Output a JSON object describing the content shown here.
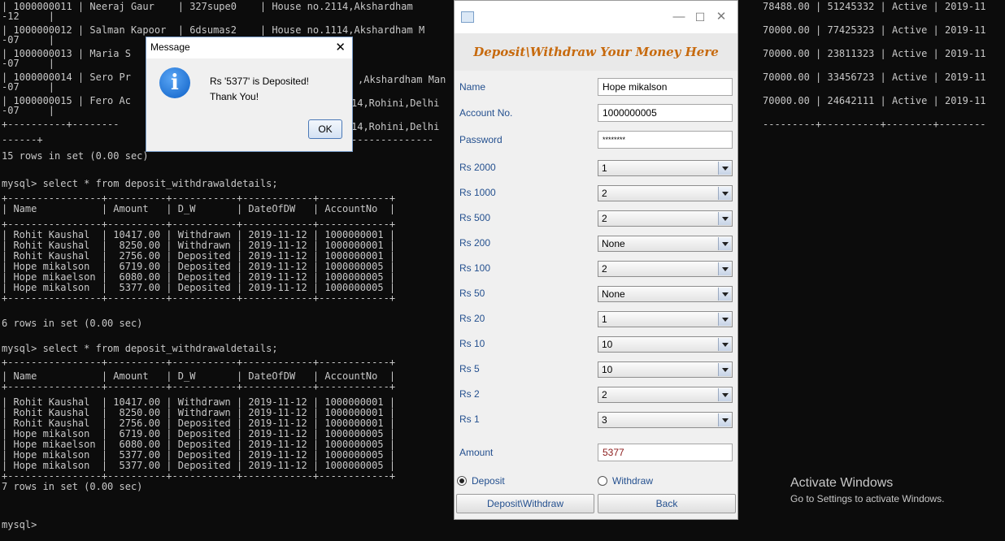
{
  "terminal": {
    "left_lines": [
      "| 1000000011 | Neeraj Gaur    | 327supe0    | House no.2114,Akshardham",
      "-12     |",
      "| 1000000012 | Salman Kapoor  | 6dsumas2    | House no.1114,Akshardham M",
      "-07     |",
      "| 1000000013 | Maria S",
      "-07     |",
      "| 1000000014 | Sero Pr",
      "-07     |",
      "| 1000000015 | Fero Ac",
      "-07     |",
      "+----------+--------",
      "",
      "------+",
      "15 rows in set (0.00 sec)",
      "",
      "mysql> select * from deposit_withdrawaldetails;",
      "+----------------+----------+-----------+------------+------------+",
      "| Name           | Amount   | D_W       | DateOfDW   | AccountNo  |",
      "+----------------+----------+-----------+------------+------------+",
      "| Rohit Kaushal  | 10417.00 | Withdrawn | 2019-11-12 | 1000000001 |",
      "| Rohit Kaushal  |  8250.00 | Withdrawn | 2019-11-12 | 1000000001 |",
      "| Rohit Kaushal  |  2756.00 | Deposited | 2019-11-12 | 1000000001 |",
      "| Hope mikalson  |  6719.00 | Deposited | 2019-11-12 | 1000000005 |",
      "| Hope mikaelson |  6080.00 | Deposited | 2019-11-12 | 1000000005 |",
      "| Hope mikalson  |  5377.00 | Deposited | 2019-11-12 | 1000000005 |",
      "+----------------+----------+-----------+------------+------------+",
      "6 rows in set (0.00 sec)",
      "",
      "mysql> select * from deposit_withdrawaldetails;",
      "+----------------+----------+-----------+------------+------------+",
      "| Name           | Amount   | D_W       | DateOfDW   | AccountNo  |",
      "+----------------+----------+-----------+------------+------------+",
      "| Rohit Kaushal  | 10417.00 | Withdrawn | 2019-11-12 | 1000000001 |",
      "| Rohit Kaushal  |  8250.00 | Withdrawn | 2019-11-12 | 1000000001 |",
      "| Rohit Kaushal  |  2756.00 | Deposited | 2019-11-12 | 1000000001 |",
      "| Hope mikalson  |  6719.00 | Deposited | 2019-11-12 | 1000000005 |",
      "| Hope mikaelson |  6080.00 | Deposited | 2019-11-12 | 1000000005 |",
      "| Hope mikalson  |  5377.00 | Deposited | 2019-11-12 | 1000000005 |",
      "| Hope mikalson  |  5377.00 | Deposited | 2019-11-12 | 1000000005 |",
      "+----------------+----------+-----------+------------+------------+",
      "7 rows in set (0.00 sec)",
      "",
      "mysql>"
    ],
    "mid_lines": [
      ",Akshardham Man",
      "14,Rohini,Delhi",
      "14,Rohini,Delhi",
      "--------------"
    ],
    "right_lines": [
      "78488.00 | 51245332 | Active | 2019-11",
      "",
      "70000.00 | 77425323 | Active | 2019-11",
      "",
      "70000.00 | 23811323 | Active | 2019-11",
      "",
      "70000.00 | 33456723 | Active | 2019-11",
      "",
      "70000.00 | 24642111 | Active | 2019-11",
      "",
      "---------+----------+--------+--------"
    ]
  },
  "deposit_window": {
    "title_icon": "java-cup-icon",
    "minimize_symbol": "—",
    "maximize_symbol": "☐",
    "close_symbol": "✕",
    "heading": "Deposit\\Withdraw Your Money Here",
    "heading_color": "#c76a0e",
    "label_color": "#24508f",
    "fields": [
      {
        "label": "Name",
        "value": "Hope mikalson"
      },
      {
        "label": "Account No.",
        "value": "1000000005"
      },
      {
        "label": "Password",
        "value": "********"
      }
    ],
    "denominations": [
      {
        "label": "Rs 2000",
        "value": "1"
      },
      {
        "label": "Rs 1000",
        "value": "2"
      },
      {
        "label": "Rs 500",
        "value": "2"
      },
      {
        "label": "Rs 200",
        "value": "None"
      },
      {
        "label": "Rs 100",
        "value": "2"
      },
      {
        "label": "Rs 50",
        "value": "None"
      },
      {
        "label": "Rs 20",
        "value": "1"
      },
      {
        "label": "Rs 10",
        "value": "10"
      },
      {
        "label": "Rs 5",
        "value": "10"
      },
      {
        "label": "Rs 2",
        "value": "2"
      },
      {
        "label": "Rs 1",
        "value": "3"
      }
    ],
    "amount_label": "Amount",
    "amount_value": "5377",
    "amount_color": "#8b1a1a",
    "radio_deposit": "Deposit",
    "radio_withdraw": "Withdraw",
    "selected_radio": "Deposit",
    "submit_button": "Deposit\\Withdraw",
    "back_button": "Back"
  },
  "message_dialog": {
    "title": "Message",
    "close_symbol": "✕",
    "icon": "info-icon",
    "icon_glyph": "i",
    "message_line1": "Rs '5377' is Deposited!",
    "message_line2": "Thank You!",
    "ok_button": "OK"
  },
  "watermark": {
    "title": "Activate Windows",
    "subtitle": "Go to Settings to activate Windows."
  }
}
